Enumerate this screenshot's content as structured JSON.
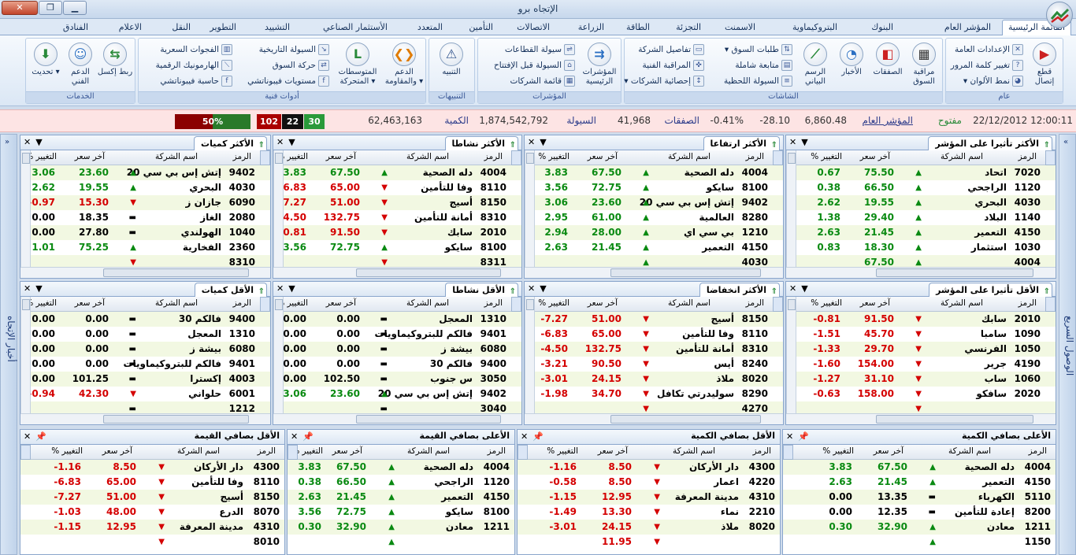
{
  "window": {
    "title": "الإتجاه برو",
    "min": "▁",
    "max": "❐",
    "close": "✕"
  },
  "tabs": [
    "القائمة الرئيسية",
    "المؤشر العام",
    "البنوك",
    "البتروكيماوية",
    "الاسمنت",
    "التجزئة",
    "الطاقة",
    "الزراعة",
    "الاتصالات",
    "التأمين",
    "المتعدد",
    "الأستثمار الصناعي",
    "التشييد",
    "التطوير",
    "النقل",
    "الاعلام",
    "الفنادق"
  ],
  "ribbon": {
    "general": {
      "label": "عام",
      "cut": "قطع إتصال",
      "settings": "الإعدادات العامة",
      "password": "تغيير كلمة المرور",
      "colors": "نمط الألوان"
    },
    "screens": {
      "label": "الشاشات",
      "watch": "مراقبة السوق",
      "deals": "الصفقات",
      "news": "الأخبار",
      "chart": "الرسم البياني",
      "orders": "طلبات السوق",
      "comp": "متابعة شاملة",
      "instant": "السيولة اللحظية",
      "details": "تفاصيل الشركة",
      "tech": "المراقبة الفنية",
      "stats": "إحصائية الشركات"
    },
    "indices": {
      "label": "المؤشرات",
      "main": "المؤشرات الرئيسية",
      "sect_liq": "سيولة القطاعات",
      "open_liq": "السيولة قبل الإفتتاح",
      "list": "قائمة الشركات"
    },
    "alerts": {
      "label": "التنبيهات",
      "alert": "التنبيه"
    },
    "tech": {
      "label": "أدوات فنية",
      "support": "الدعم والمقاومة",
      "ma": "المتوسطات المتحركة",
      "hist_liq": "السيولة التاريخية",
      "movement": "حركة السوق",
      "fib_levels": "مستويات فيبوناتشي",
      "gaps": "الفجوات السعرية",
      "harmonic": "الهارمونيك الرقمية",
      "fib_calc": "حاسبة فيبوناتشي"
    },
    "services": {
      "label": "الخدمات",
      "excel": "ربط إكسل",
      "support": "الدعم الفني",
      "update": "تحديث"
    }
  },
  "ticker": {
    "datetime": "22/12/2012 12:00:11",
    "status": "مفتوح",
    "index_label": "المؤشر العام",
    "index": "6,860.48",
    "change": "-28.10",
    "pct": "-0.41%",
    "deals_label": "الصفقات",
    "deals": "41,968",
    "liq_label": "السيولة",
    "liq": "1,874,542,792",
    "qty_label": "الكمية",
    "qty": "62,463,163",
    "up": "30",
    "same": "22",
    "down": "102",
    "pct_bar": "50%"
  },
  "rails": {
    "right": "الوصول السريع",
    "left": "أخبار الإتجاه"
  },
  "cols": {
    "code": "الرمز",
    "name": "اسم الشركة",
    "last": "آخر سعر",
    "chg": "% التغيير"
  },
  "colors": {
    "up": "#0a8a12",
    "down": "#d40000"
  },
  "panels": [
    {
      "title": "الأكثر تأثيرا على المؤشر",
      "rows": [
        [
          "7020",
          "اتحاد",
          "75.50",
          "0.67",
          "u"
        ],
        [
          "1120",
          "الراجحي",
          "66.50",
          "0.38",
          "u"
        ],
        [
          "4030",
          "البحري",
          "19.55",
          "2.62",
          "u"
        ],
        [
          "1140",
          "البلاد",
          "29.40",
          "1.38",
          "u"
        ],
        [
          "4150",
          "التعمير",
          "21.45",
          "2.63",
          "u"
        ],
        [
          "1030",
          "استثمار",
          "18.30",
          "0.83",
          "u"
        ],
        [
          "4004",
          "",
          "67.50",
          "",
          "u"
        ]
      ]
    },
    {
      "title": "الأكثر ارتفاعا",
      "rows": [
        [
          "4004",
          "دله الصحية",
          "67.50",
          "3.83",
          "u"
        ],
        [
          "8100",
          "سايكو",
          "72.75",
          "3.56",
          "u"
        ],
        [
          "9402",
          "إتش إس بي سي 20",
          "23.60",
          "3.06",
          "u"
        ],
        [
          "8280",
          "العالمية",
          "61.00",
          "2.95",
          "u"
        ],
        [
          "1210",
          "بي سي اي",
          "28.00",
          "2.94",
          "u"
        ],
        [
          "4150",
          "التعمير",
          "21.45",
          "2.63",
          "u"
        ],
        [
          "4030",
          "",
          "",
          "",
          "u"
        ]
      ]
    },
    {
      "title": "الأكثر نشاطا",
      "rows": [
        [
          "4004",
          "دله الصحية",
          "67.50",
          "3.83",
          "u"
        ],
        [
          "8110",
          "وفا للتأمين",
          "65.00",
          "-6.83",
          "d"
        ],
        [
          "8150",
          "أسيج",
          "51.00",
          "-7.27",
          "d"
        ],
        [
          "8310",
          "أمانة للتأمين",
          "132.75",
          "-4.50",
          "d"
        ],
        [
          "2010",
          "سابك",
          "91.50",
          "-0.81",
          "d"
        ],
        [
          "8100",
          "سايكو",
          "72.75",
          "3.56",
          "u"
        ],
        [
          "8311",
          "",
          "",
          "",
          "d"
        ]
      ]
    },
    {
      "title": "الأكثر كميات",
      "rows": [
        [
          "9402",
          "إتش إس بي سي 20",
          "23.60",
          "3.06",
          "u"
        ],
        [
          "4030",
          "البحري",
          "19.55",
          "2.62",
          "u"
        ],
        [
          "6090",
          "جازان ز",
          "15.30",
          "-0.97",
          "d"
        ],
        [
          "2080",
          "الغاز",
          "18.35",
          "0.00",
          "n"
        ],
        [
          "1040",
          "الهولندي",
          "27.80",
          "0.00",
          "n"
        ],
        [
          "2360",
          "الفخارية",
          "75.25",
          "1.01",
          "u"
        ],
        [
          "8310",
          "",
          "",
          "",
          "d"
        ]
      ]
    },
    {
      "title": "الأقل تأثيرا على المؤشر",
      "rows": [
        [
          "2010",
          "سابك",
          "91.50",
          "-0.81",
          "d"
        ],
        [
          "1090",
          "سامبا",
          "45.70",
          "-1.51",
          "d"
        ],
        [
          "1050",
          "الفرنسي",
          "29.70",
          "-1.33",
          "d"
        ],
        [
          "4190",
          "جرير",
          "154.00",
          "-1.60",
          "d"
        ],
        [
          "1060",
          "ساب",
          "31.10",
          "-1.27",
          "d"
        ],
        [
          "2020",
          "سافكو",
          "158.00",
          "-0.63",
          "d"
        ],
        [
          "",
          "",
          "",
          "",
          "d"
        ]
      ]
    },
    {
      "title": "الأكثر انخفاضا",
      "rows": [
        [
          "8150",
          "أسيج",
          "51.00",
          "-7.27",
          "d"
        ],
        [
          "8110",
          "وفا للتأمين",
          "65.00",
          "-6.83",
          "d"
        ],
        [
          "8310",
          "أمانة للتأمين",
          "132.75",
          "-4.50",
          "d"
        ],
        [
          "8240",
          "أيس",
          "90.50",
          "-3.21",
          "d"
        ],
        [
          "8020",
          "ملاذ",
          "24.15",
          "-3.01",
          "d"
        ],
        [
          "8290",
          "سوليدرتي تكافل",
          "34.70",
          "-1.98",
          "d"
        ],
        [
          "4270",
          "",
          "",
          "",
          "d"
        ]
      ]
    },
    {
      "title": "الأقل نشاطا",
      "rows": [
        [
          "1310",
          "المعجل",
          "0.00",
          "0.00",
          "n"
        ],
        [
          "9401",
          "فالكم للبتروكيماويات",
          "0.00",
          "0.00",
          "n"
        ],
        [
          "6080",
          "بيشة ز",
          "0.00",
          "0.00",
          "n"
        ],
        [
          "9400",
          "فالكم 30",
          "0.00",
          "0.00",
          "n"
        ],
        [
          "3050",
          "س جنوب",
          "102.50",
          "0.00",
          "n"
        ],
        [
          "9402",
          "إتش إس بي سي 20",
          "23.60",
          "3.06",
          "u"
        ],
        [
          "3040",
          "",
          "",
          "",
          "n"
        ]
      ]
    },
    {
      "title": "الأقل كميات",
      "rows": [
        [
          "9400",
          "فالكم 30",
          "0.00",
          "0.00",
          "n"
        ],
        [
          "1310",
          "المعجل",
          "0.00",
          "0.00",
          "n"
        ],
        [
          "6080",
          "بيشة ز",
          "0.00",
          "0.00",
          "n"
        ],
        [
          "9401",
          "فالكم للبتروكيماويات",
          "0.00",
          "0.00",
          "n"
        ],
        [
          "4003",
          "إكسترا",
          "101.25",
          "0.00",
          "n"
        ],
        [
          "6001",
          "حلواني",
          "42.30",
          "-0.94",
          "d"
        ],
        [
          "1212",
          "",
          "",
          "",
          "n"
        ]
      ]
    },
    {
      "title": "الأعلى بصافي الكمية",
      "rows": [
        [
          "4004",
          "دله الصحية",
          "67.50",
          "3.83",
          "u"
        ],
        [
          "4150",
          "التعمير",
          "21.45",
          "2.63",
          "u"
        ],
        [
          "5110",
          "الكهرباء",
          "13.35",
          "0.00",
          "n"
        ],
        [
          "8200",
          "إعادة للتأمين",
          "12.35",
          "0.00",
          "n"
        ],
        [
          "1211",
          "معادن",
          "32.90",
          "0.30",
          "u"
        ],
        [
          "1150",
          "",
          "",
          "",
          "u"
        ]
      ]
    },
    {
      "title": "الأقل بصافي الكمية",
      "rows": [
        [
          "4300",
          "دار الأركان",
          "8.50",
          "-1.16",
          "d"
        ],
        [
          "4220",
          "اعمار",
          "8.50",
          "-0.58",
          "d"
        ],
        [
          "4310",
          "مدينة المعرفة",
          "12.95",
          "-1.15",
          "d"
        ],
        [
          "2210",
          "نماء",
          "13.30",
          "-1.49",
          "d"
        ],
        [
          "8020",
          "ملاذ",
          "24.15",
          "-3.01",
          "d"
        ],
        [
          "",
          "",
          "11.95",
          "",
          "d"
        ]
      ]
    },
    {
      "title": "الأعلى بصافي القيمة",
      "rows": [
        [
          "4004",
          "دله الصحية",
          "67.50",
          "3.83",
          "u"
        ],
        [
          "1120",
          "الراجحي",
          "66.50",
          "0.38",
          "u"
        ],
        [
          "4150",
          "التعمير",
          "21.45",
          "2.63",
          "u"
        ],
        [
          "8100",
          "سايكو",
          "72.75",
          "3.56",
          "u"
        ],
        [
          "1211",
          "معادن",
          "32.90",
          "0.30",
          "u"
        ],
        [
          "",
          "",
          "",
          "",
          "u"
        ]
      ]
    },
    {
      "title": "الأقل بصافي القيمة",
      "rows": [
        [
          "4300",
          "دار الأركان",
          "8.50",
          "-1.16",
          "d"
        ],
        [
          "8110",
          "وفا للتأمين",
          "65.00",
          "-6.83",
          "d"
        ],
        [
          "8150",
          "أسيج",
          "51.00",
          "-7.27",
          "d"
        ],
        [
          "8070",
          "الدرع",
          "48.00",
          "-1.03",
          "d"
        ],
        [
          "4310",
          "مدينة المعرفة",
          "12.95",
          "-1.15",
          "d"
        ],
        [
          "8010",
          "",
          "",
          "",
          "d"
        ]
      ]
    }
  ]
}
